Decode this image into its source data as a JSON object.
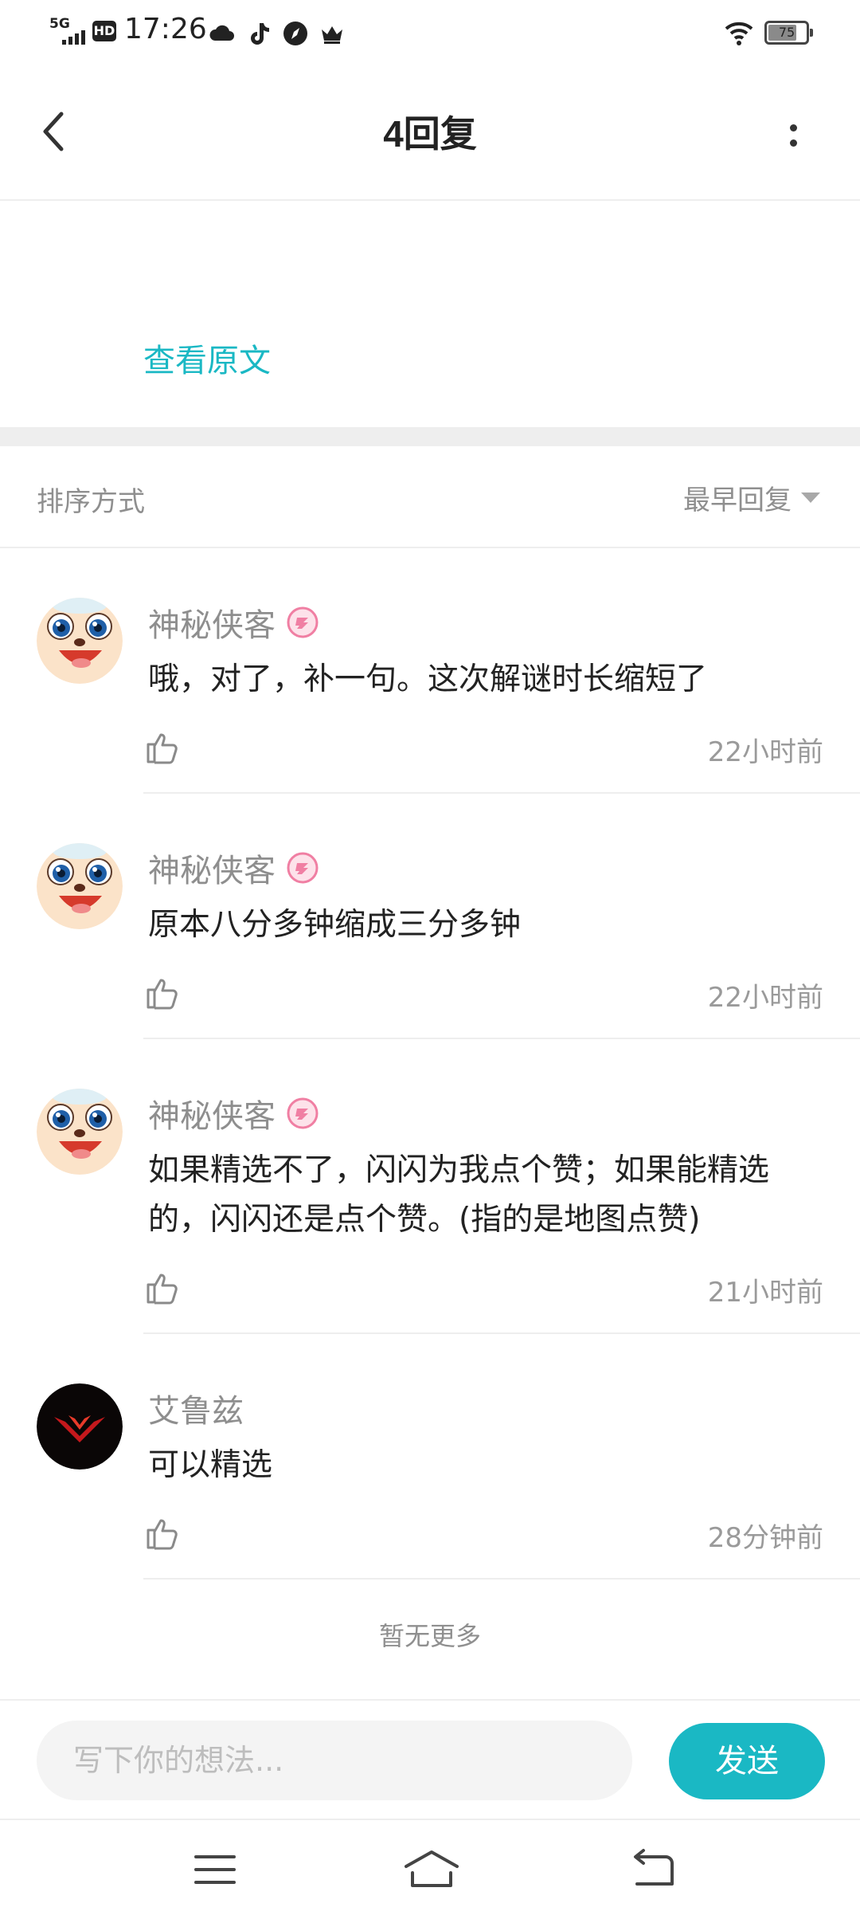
{
  "status_bar": {
    "network": "5G",
    "hd": "HD",
    "time": "17:26",
    "battery": "75",
    "battery_level": 0.75,
    "icons": [
      "cloud-icon",
      "tiktok-icon",
      "compass-icon",
      "crown-icon"
    ]
  },
  "header": {
    "title": "4回复",
    "back_icon": "chevron-left-icon",
    "more_icon": "more-vertical-icon"
  },
  "original": {
    "link_label": "查看原文"
  },
  "sort": {
    "label": "排序方式",
    "selected": "最早回复"
  },
  "comments": [
    {
      "user": "神秘侠客",
      "avatar": "cartoon-face",
      "badge": true,
      "text": "哦，对了，补一句。这次解谜时长缩短了",
      "time": "22小时前"
    },
    {
      "user": "神秘侠客",
      "avatar": "cartoon-face",
      "badge": true,
      "text": "原本八分多钟缩成三分多钟",
      "time": "22小时前"
    },
    {
      "user": "神秘侠客",
      "avatar": "cartoon-face",
      "badge": true,
      "text": "如果精选不了，闪闪为我点个赞；如果能精选的，闪闪还是点个赞。(指的是地图点赞)",
      "time": "21小时前"
    },
    {
      "user": "艾鲁兹",
      "avatar": "dark-logo",
      "badge": false,
      "text": "可以精选",
      "time": "28分钟前"
    }
  ],
  "footer_note": "暂无更多",
  "composer": {
    "placeholder": "写下你的想法...",
    "send_label": "发送"
  },
  "colors": {
    "accent": "#1ab8c4",
    "badge_pink": "#f07fa3"
  }
}
